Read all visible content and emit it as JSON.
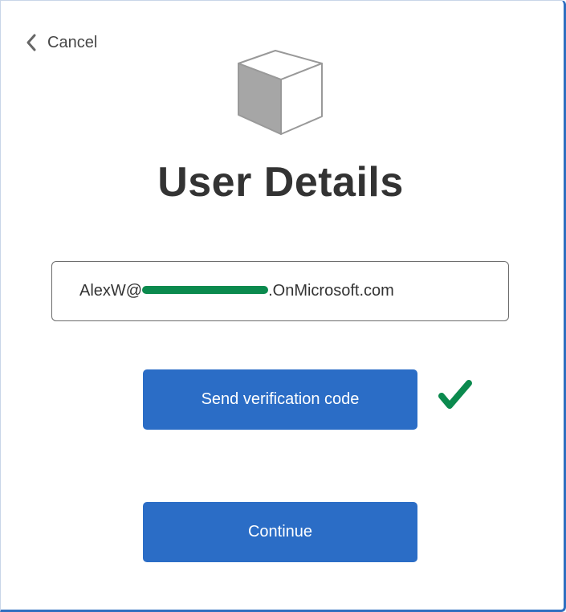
{
  "nav": {
    "cancel_label": "Cancel",
    "cancel_icon": "chevron-left-icon"
  },
  "header": {
    "logo_icon": "cube-icon",
    "title": "User Details"
  },
  "form": {
    "email_prefix": "AlexW@",
    "email_suffix": ".OnMicrosoft.com",
    "send_code_label": "Send verification code",
    "verified_icon": "checkmark-icon",
    "continue_label": "Continue"
  },
  "colors": {
    "accent": "#2b6dc6",
    "check": "#0b8a4e",
    "redaction": "#0b8a4e",
    "title_text": "#333333"
  }
}
